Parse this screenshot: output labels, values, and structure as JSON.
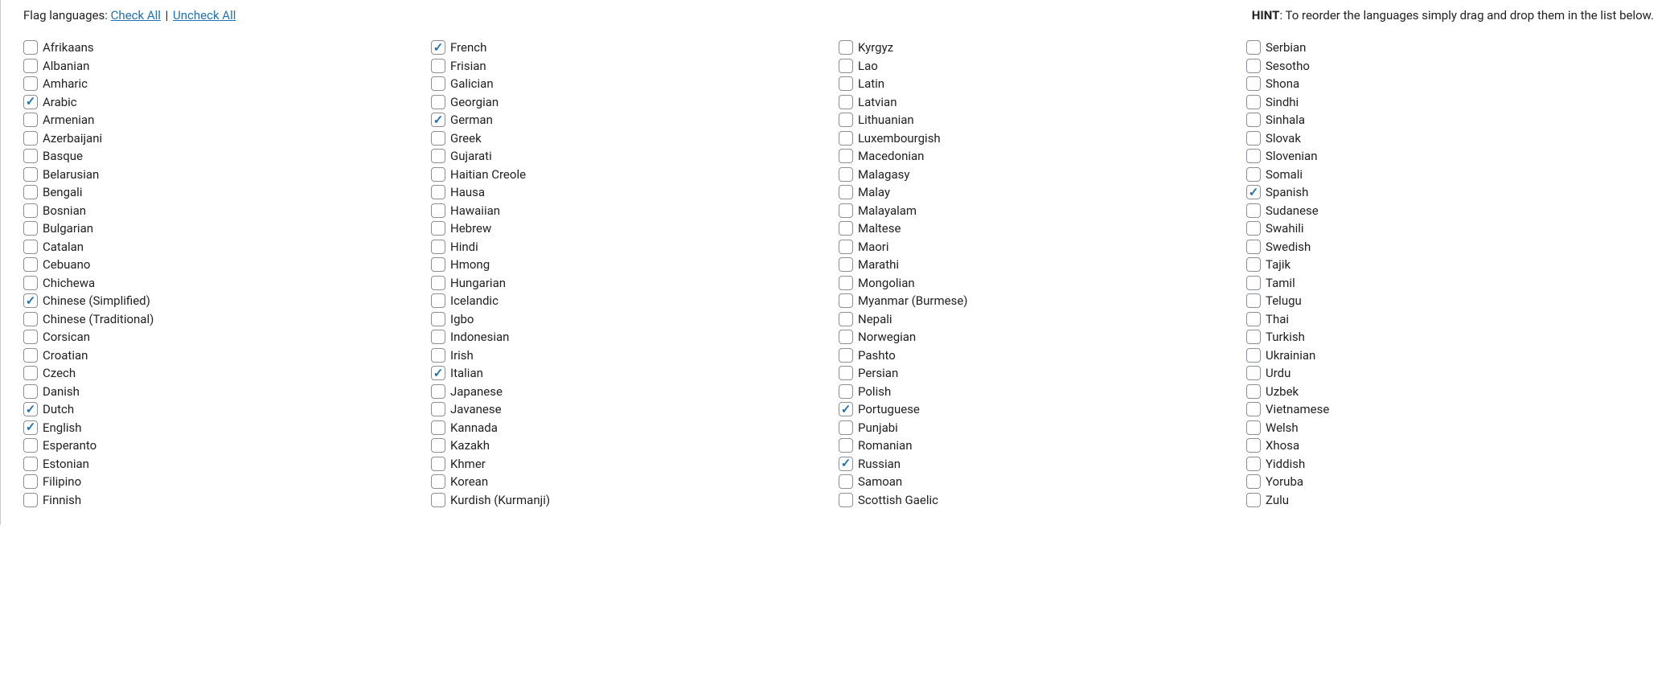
{
  "header": {
    "flag_label": "Flag languages:",
    "check_all": "Check All",
    "uncheck_all": "Uncheck All",
    "hint_label": "HINT",
    "hint_text": ": To reorder the languages simply drag and drop them in the list below."
  },
  "columns": [
    [
      {
        "label": "Afrikaans",
        "checked": false
      },
      {
        "label": "Albanian",
        "checked": false
      },
      {
        "label": "Amharic",
        "checked": false
      },
      {
        "label": "Arabic",
        "checked": true
      },
      {
        "label": "Armenian",
        "checked": false
      },
      {
        "label": "Azerbaijani",
        "checked": false
      },
      {
        "label": "Basque",
        "checked": false
      },
      {
        "label": "Belarusian",
        "checked": false
      },
      {
        "label": "Bengali",
        "checked": false
      },
      {
        "label": "Bosnian",
        "checked": false
      },
      {
        "label": "Bulgarian",
        "checked": false
      },
      {
        "label": "Catalan",
        "checked": false
      },
      {
        "label": "Cebuano",
        "checked": false
      },
      {
        "label": "Chichewa",
        "checked": false
      },
      {
        "label": "Chinese (Simplified)",
        "checked": true
      },
      {
        "label": "Chinese (Traditional)",
        "checked": false
      },
      {
        "label": "Corsican",
        "checked": false
      },
      {
        "label": "Croatian",
        "checked": false
      },
      {
        "label": "Czech",
        "checked": false
      },
      {
        "label": "Danish",
        "checked": false
      },
      {
        "label": "Dutch",
        "checked": true
      },
      {
        "label": "English",
        "checked": true
      },
      {
        "label": "Esperanto",
        "checked": false
      },
      {
        "label": "Estonian",
        "checked": false
      },
      {
        "label": "Filipino",
        "checked": false
      },
      {
        "label": "Finnish",
        "checked": false
      }
    ],
    [
      {
        "label": "French",
        "checked": true
      },
      {
        "label": "Frisian",
        "checked": false
      },
      {
        "label": "Galician",
        "checked": false
      },
      {
        "label": "Georgian",
        "checked": false
      },
      {
        "label": "German",
        "checked": true
      },
      {
        "label": "Greek",
        "checked": false
      },
      {
        "label": "Gujarati",
        "checked": false
      },
      {
        "label": "Haitian Creole",
        "checked": false
      },
      {
        "label": "Hausa",
        "checked": false
      },
      {
        "label": "Hawaiian",
        "checked": false
      },
      {
        "label": "Hebrew",
        "checked": false
      },
      {
        "label": "Hindi",
        "checked": false
      },
      {
        "label": "Hmong",
        "checked": false
      },
      {
        "label": "Hungarian",
        "checked": false
      },
      {
        "label": "Icelandic",
        "checked": false
      },
      {
        "label": "Igbo",
        "checked": false
      },
      {
        "label": "Indonesian",
        "checked": false
      },
      {
        "label": "Irish",
        "checked": false
      },
      {
        "label": "Italian",
        "checked": true
      },
      {
        "label": "Japanese",
        "checked": false
      },
      {
        "label": "Javanese",
        "checked": false
      },
      {
        "label": "Kannada",
        "checked": false
      },
      {
        "label": "Kazakh",
        "checked": false
      },
      {
        "label": "Khmer",
        "checked": false
      },
      {
        "label": "Korean",
        "checked": false
      },
      {
        "label": "Kurdish (Kurmanji)",
        "checked": false
      }
    ],
    [
      {
        "label": "Kyrgyz",
        "checked": false
      },
      {
        "label": "Lao",
        "checked": false
      },
      {
        "label": "Latin",
        "checked": false
      },
      {
        "label": "Latvian",
        "checked": false
      },
      {
        "label": "Lithuanian",
        "checked": false
      },
      {
        "label": "Luxembourgish",
        "checked": false
      },
      {
        "label": "Macedonian",
        "checked": false
      },
      {
        "label": "Malagasy",
        "checked": false
      },
      {
        "label": "Malay",
        "checked": false
      },
      {
        "label": "Malayalam",
        "checked": false
      },
      {
        "label": "Maltese",
        "checked": false
      },
      {
        "label": "Maori",
        "checked": false
      },
      {
        "label": "Marathi",
        "checked": false
      },
      {
        "label": "Mongolian",
        "checked": false
      },
      {
        "label": "Myanmar (Burmese)",
        "checked": false
      },
      {
        "label": "Nepali",
        "checked": false
      },
      {
        "label": "Norwegian",
        "checked": false
      },
      {
        "label": "Pashto",
        "checked": false
      },
      {
        "label": "Persian",
        "checked": false
      },
      {
        "label": "Polish",
        "checked": false
      },
      {
        "label": "Portuguese",
        "checked": true
      },
      {
        "label": "Punjabi",
        "checked": false
      },
      {
        "label": "Romanian",
        "checked": false
      },
      {
        "label": "Russian",
        "checked": true
      },
      {
        "label": "Samoan",
        "checked": false
      },
      {
        "label": "Scottish Gaelic",
        "checked": false
      }
    ],
    [
      {
        "label": "Serbian",
        "checked": false
      },
      {
        "label": "Sesotho",
        "checked": false
      },
      {
        "label": "Shona",
        "checked": false
      },
      {
        "label": "Sindhi",
        "checked": false
      },
      {
        "label": "Sinhala",
        "checked": false
      },
      {
        "label": "Slovak",
        "checked": false
      },
      {
        "label": "Slovenian",
        "checked": false
      },
      {
        "label": "Somali",
        "checked": false
      },
      {
        "label": "Spanish",
        "checked": true
      },
      {
        "label": "Sudanese",
        "checked": false
      },
      {
        "label": "Swahili",
        "checked": false
      },
      {
        "label": "Swedish",
        "checked": false
      },
      {
        "label": "Tajik",
        "checked": false
      },
      {
        "label": "Tamil",
        "checked": false
      },
      {
        "label": "Telugu",
        "checked": false
      },
      {
        "label": "Thai",
        "checked": false
      },
      {
        "label": "Turkish",
        "checked": false
      },
      {
        "label": "Ukrainian",
        "checked": false
      },
      {
        "label": "Urdu",
        "checked": false
      },
      {
        "label": "Uzbek",
        "checked": false
      },
      {
        "label": "Vietnamese",
        "checked": false
      },
      {
        "label": "Welsh",
        "checked": false
      },
      {
        "label": "Xhosa",
        "checked": false
      },
      {
        "label": "Yiddish",
        "checked": false
      },
      {
        "label": "Yoruba",
        "checked": false
      },
      {
        "label": "Zulu",
        "checked": false
      }
    ]
  ]
}
